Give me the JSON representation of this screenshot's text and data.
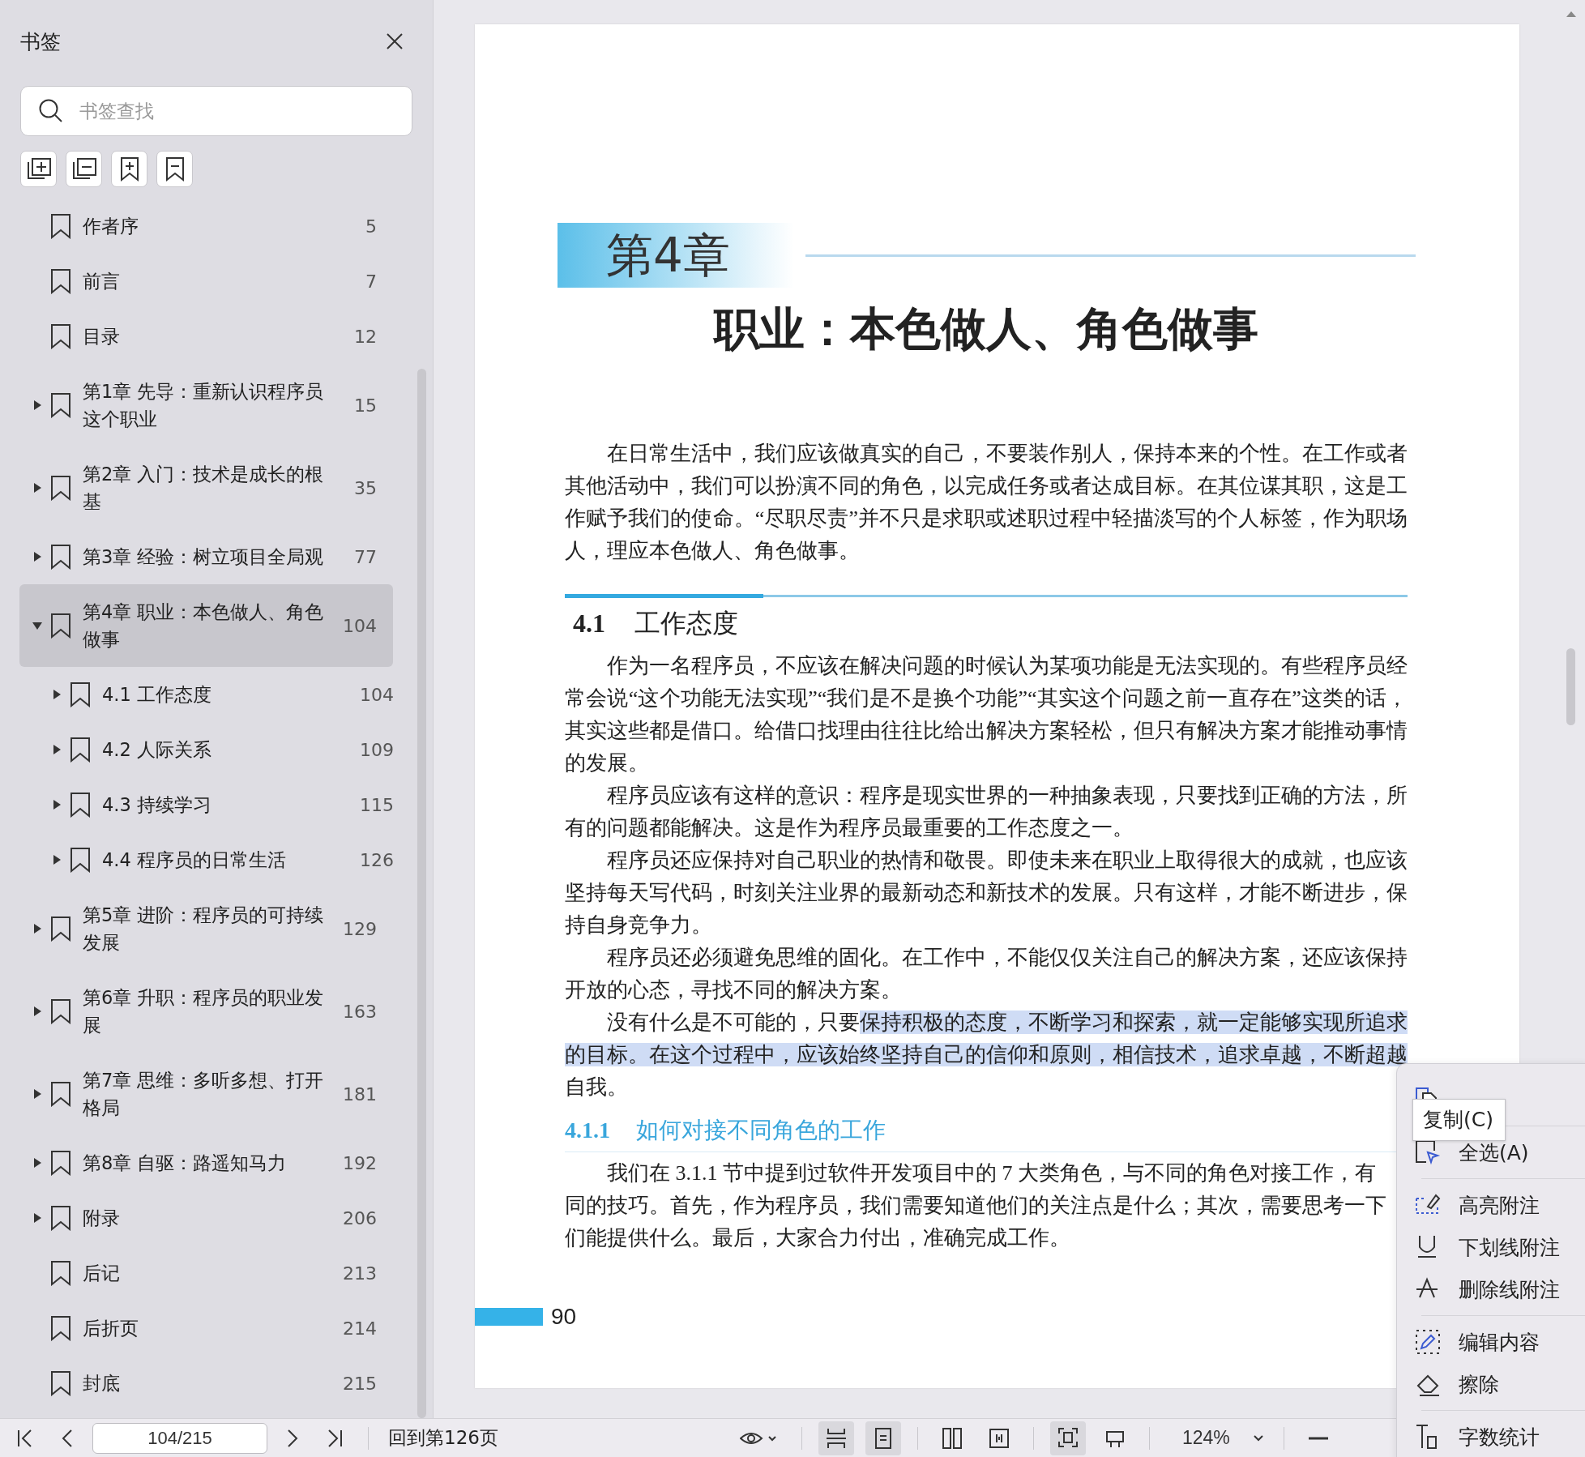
{
  "sidebar": {
    "title": "书签",
    "search": {
      "placeholder": "书签查找"
    },
    "bookmarks": [
      {
        "label": "作者序",
        "page": "5",
        "has_children": false,
        "selected": false
      },
      {
        "label": "前言",
        "page": "7",
        "has_children": false,
        "selected": false
      },
      {
        "label": "目录",
        "page": "12",
        "has_children": false,
        "selected": false
      },
      {
        "label": "第1章 先导：重新认识程序员这个职业",
        "page": "15",
        "has_children": true,
        "expanded": false,
        "selected": false
      },
      {
        "label": "第2章 入门：技术是成长的根基",
        "page": "35",
        "has_children": true,
        "expanded": false,
        "selected": false
      },
      {
        "label": "第3章 经验：树立项目全局观",
        "page": "77",
        "has_children": true,
        "expanded": false,
        "selected": false
      },
      {
        "label": "第4章 职业：本色做人、角色做事",
        "page": "104",
        "has_children": true,
        "expanded": true,
        "selected": true,
        "children": [
          {
            "label": "4.1 工作态度",
            "page": "104",
            "has_children": true,
            "expanded": false,
            "selected": false
          },
          {
            "label": "4.2 人际关系",
            "page": "109",
            "has_children": true,
            "expanded": false,
            "selected": false
          },
          {
            "label": "4.3 持续学习",
            "page": "115",
            "has_children": true,
            "expanded": false,
            "selected": false
          },
          {
            "label": "4.4 程序员的日常生活",
            "page": "126",
            "has_children": true,
            "expanded": false,
            "selected": false
          }
        ]
      },
      {
        "label": "第5章 进阶：程序员的可持续发展",
        "page": "129",
        "has_children": true,
        "expanded": false,
        "selected": false
      },
      {
        "label": "第6章 升职：程序员的职业发展",
        "page": "163",
        "has_children": true,
        "expanded": false,
        "selected": false
      },
      {
        "label": "第7章 思维：多听多想、打开格局",
        "page": "181",
        "has_children": true,
        "expanded": false,
        "selected": false
      },
      {
        "label": "第8章 自驱：路遥知马力",
        "page": "192",
        "has_children": true,
        "expanded": false,
        "selected": false
      },
      {
        "label": "附录",
        "page": "206",
        "has_children": true,
        "expanded": false,
        "selected": false
      },
      {
        "label": "后记",
        "page": "213",
        "has_children": false,
        "selected": false
      },
      {
        "label": "后折页",
        "page": "214",
        "has_children": false,
        "selected": false
      },
      {
        "label": "封底",
        "page": "215",
        "has_children": false,
        "selected": false
      }
    ]
  },
  "document": {
    "chapter_label": "第4章",
    "chapter_title": "职业：本色做人、角色做事",
    "blocks": [
      {
        "kind": "paragraph",
        "text": "在日常生活中，我们应该做真实的自己，不要装作别人，保持本来的个性。在工作或者其他活动中，我们可以扮演不同的角色，以完成任务或者达成目标。在其位谋其职，这是工作赋予我们的使命。“尽职尽责”并不只是求职或述职过程中轻描淡写的个人标签，作为职场人，理应本色做人、角色做事。"
      },
      {
        "kind": "heading",
        "number": "4.1",
        "text": "工作态度"
      },
      {
        "kind": "paragraph",
        "text": "作为一名程序员，不应该在解决问题的时候认为某项功能是无法实现的。有些程序员经常会说“这个功能无法实现”“我们是不是换个功能”“其实这个问题之前一直存在”这类的话，其实这些都是借口。给借口找理由往往比给出解决方案轻松，但只有解决方案才能推动事情的发展。"
      },
      {
        "kind": "paragraph",
        "text": "程序员应该有这样的意识：程序是现实世界的一种抽象表现，只要找到正确的方法，所有的问题都能解决。这是作为程序员最重要的工作态度之一。"
      },
      {
        "kind": "paragraph",
        "text": "程序员还应保持对自己职业的热情和敬畏。即使未来在职业上取得很大的成就，也应该坚持每天写代码，时刻关注业界的最新动态和新技术的发展。只有这样，才能不断进步，保持自身竞争力。"
      },
      {
        "kind": "paragraph",
        "text": "程序员还必须避免思维的固化。在工作中，不能仅仅关注自己的解决方案，还应该保持开放的心态，寻找不同的解决方案。"
      },
      {
        "kind": "selection",
        "text": "没有什么是不可能的，只要",
        "selected_text": "保持积极的态度，不断学习和探索，就一定能够实现所追求的目标。在这个过程中，应该始终坚持自己的信仰和原则，相信技术，追求卓越，不断超越",
        "text_after": "自我。"
      },
      {
        "kind": "subheading",
        "number": "4.1.1",
        "text": "如何对接不同角色的工作"
      },
      {
        "kind": "lines",
        "lines": [
          "我们在 3.1.1 节中提到过软件开发项目中的 7 大类角色，与不同的角色对接工作，有",
          "同的技巧。首先，作为程序员，我们需要知道他们的关注点是什么；其次，需要思考一下",
          "们能提供什么。最后，大家合力付出，准确完成工作。"
        ]
      }
    ],
    "page_number": "90"
  },
  "context_menu": {
    "tooltip": "复制(C)",
    "items": [
      {
        "kind": "copy"
      },
      {
        "kind": "separator"
      },
      {
        "kind": "select_all",
        "label": "全选(A)"
      },
      {
        "kind": "separator"
      },
      {
        "kind": "highlight",
        "label": "高亮附注"
      },
      {
        "kind": "underline",
        "label": "下划线附注"
      },
      {
        "kind": "strikeout",
        "label": "删除线附注"
      },
      {
        "kind": "separator"
      },
      {
        "kind": "edit",
        "label": "编辑内容"
      },
      {
        "kind": "erase",
        "label": "擦除"
      },
      {
        "kind": "separator"
      },
      {
        "kind": "word_count",
        "label": "字数统计"
      }
    ]
  },
  "toolbar": {
    "page_field": "104/215",
    "back_link": "回到第126页",
    "zoom": "124%",
    "view_buttons": [
      {
        "kind": "scroll",
        "selected": true
      },
      {
        "kind": "single",
        "selected": true
      },
      {
        "kind": "double",
        "selected": false
      },
      {
        "kind": "book",
        "selected": false
      },
      {
        "kind": "fit",
        "selected": true
      },
      {
        "kind": "rotate",
        "selected": false
      }
    ]
  }
}
